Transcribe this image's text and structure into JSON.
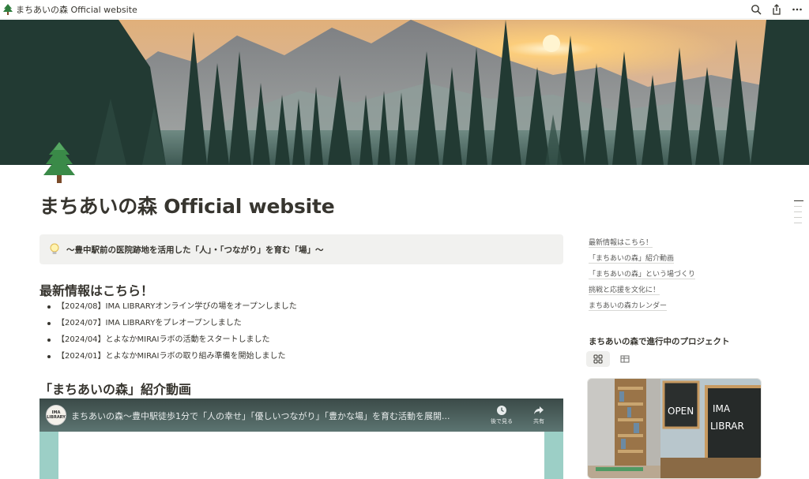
{
  "topbar": {
    "title": "まちあいの森 Official website",
    "actions": [
      "search-icon",
      "share-icon",
      "more-icon"
    ]
  },
  "page": {
    "icon": "tree-icon",
    "title": "まちあいの森 Official website"
  },
  "callout": {
    "icon": "lightbulb-icon",
    "text": "〜豊中駅前の医院跡地を活用した「人」・「つながり」を育む「場」〜"
  },
  "news": {
    "heading": "最新情報はこちら！",
    "items": [
      "【2024/08】IMA LIBRARYオンライン学びの場をオープンしました",
      "【2024/07】IMA LIBRARYをプレオープンしました",
      "【2024/04】とよなかMIRAIラボの活動をスタートしました",
      "【2024/01】とよなかMIRAIラボの取り組み準備を開始しました"
    ]
  },
  "video_section": {
    "heading": "「まちあいの森」紹介動画",
    "video_title": "まちあいの森〜豊中駅徒歩1分で「人の幸せ」「優しいつながり」「豊かな場」を育む活動を展開...",
    "channel_label": "IMA LIBRARY",
    "watch_later": "後で見る",
    "share": "共有"
  },
  "toc": {
    "items": [
      "最新情報はこちら！",
      "「まちあいの森」紹介動画",
      "「まちあいの森」という場づくり",
      "挑戦と応援を文化に！",
      "まちあいの森カレンダー"
    ]
  },
  "projects": {
    "heading": "まちあいの森で進行中のプロジェクト",
    "views": [
      "gallery-view-icon",
      "table-view-icon"
    ],
    "card_sign_open": "OPEN",
    "card_sign_library": "IMA LIBRARY"
  },
  "colors": {
    "text": "#37352f",
    "callout_bg": "#f1f1ef",
    "video_accent": "#9ccfc6"
  }
}
